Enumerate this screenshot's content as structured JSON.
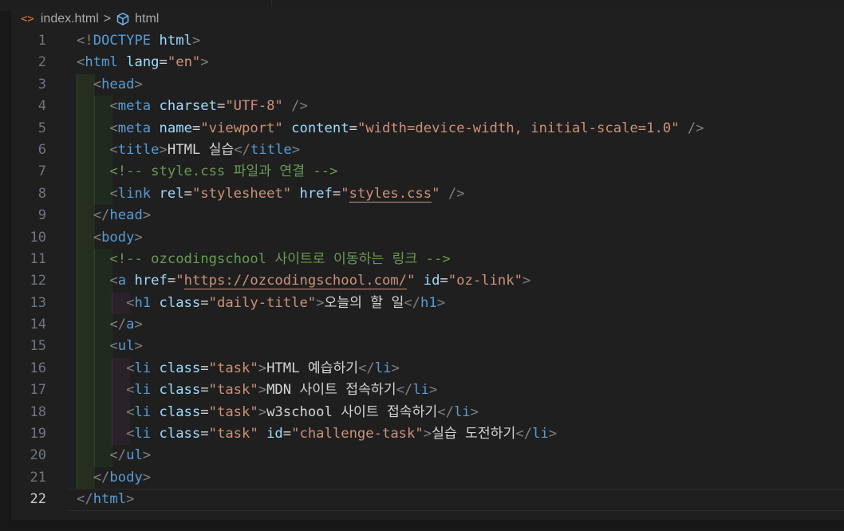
{
  "breadcrumb": {
    "file_icon": "<>",
    "file": "index.html",
    "separator": ">",
    "element": "html"
  },
  "colors": {
    "tag": "#569cd6",
    "attribute": "#9cdcfe",
    "string": "#ce9178",
    "comment": "#6a9955",
    "bracket": "#808080",
    "text": "#d4d4d4",
    "line_number": "#6e7681",
    "background": "#1f1f1f"
  },
  "active_line": 22,
  "lines": [
    {
      "n": "1",
      "tokens": [
        [
          "b",
          "<!"
        ],
        [
          "dt",
          "DOCTYPE"
        ],
        [
          "p",
          " "
        ],
        [
          "a",
          "html"
        ],
        [
          "b",
          ">"
        ]
      ]
    },
    {
      "n": "2",
      "tokens": [
        [
          "b",
          "<"
        ],
        [
          "t",
          "html"
        ],
        [
          "p",
          " "
        ],
        [
          "a",
          "lang"
        ],
        [
          "p",
          "="
        ],
        [
          "s",
          "\"en\""
        ],
        [
          "b",
          ">"
        ]
      ]
    },
    {
      "n": "3",
      "tokens": [
        [
          "p",
          "  "
        ],
        [
          "b",
          "<"
        ],
        [
          "t",
          "head"
        ],
        [
          "b",
          ">"
        ]
      ]
    },
    {
      "n": "4",
      "tokens": [
        [
          "p",
          "    "
        ],
        [
          "b",
          "<"
        ],
        [
          "t",
          "meta"
        ],
        [
          "p",
          " "
        ],
        [
          "a",
          "charset"
        ],
        [
          "p",
          "="
        ],
        [
          "s",
          "\"UTF-8\""
        ],
        [
          "p",
          " "
        ],
        [
          "b",
          "/>"
        ]
      ]
    },
    {
      "n": "5",
      "tokens": [
        [
          "p",
          "    "
        ],
        [
          "b",
          "<"
        ],
        [
          "t",
          "meta"
        ],
        [
          "p",
          " "
        ],
        [
          "a",
          "name"
        ],
        [
          "p",
          "="
        ],
        [
          "s",
          "\"viewport\""
        ],
        [
          "p",
          " "
        ],
        [
          "a",
          "content"
        ],
        [
          "p",
          "="
        ],
        [
          "s",
          "\"width=device-width, initial-scale=1.0\""
        ],
        [
          "p",
          " "
        ],
        [
          "b",
          "/>"
        ]
      ]
    },
    {
      "n": "6",
      "tokens": [
        [
          "p",
          "    "
        ],
        [
          "b",
          "<"
        ],
        [
          "t",
          "title"
        ],
        [
          "b",
          ">"
        ],
        [
          "p",
          "HTML 실습"
        ],
        [
          "b",
          "</"
        ],
        [
          "t",
          "title"
        ],
        [
          "b",
          ">"
        ]
      ]
    },
    {
      "n": "7",
      "tokens": [
        [
          "p",
          "    "
        ],
        [
          "c",
          "<!-- style.css 파일과 연결 -->"
        ]
      ]
    },
    {
      "n": "8",
      "tokens": [
        [
          "p",
          "    "
        ],
        [
          "b",
          "<"
        ],
        [
          "t",
          "link"
        ],
        [
          "p",
          " "
        ],
        [
          "a",
          "rel"
        ],
        [
          "p",
          "="
        ],
        [
          "s",
          "\"stylesheet\""
        ],
        [
          "p",
          " "
        ],
        [
          "a",
          "href"
        ],
        [
          "p",
          "="
        ],
        [
          "s",
          "\""
        ],
        [
          "su",
          "styles.css"
        ],
        [
          "s",
          "\""
        ],
        [
          "p",
          " "
        ],
        [
          "b",
          "/>"
        ]
      ]
    },
    {
      "n": "9",
      "tokens": [
        [
          "p",
          "  "
        ],
        [
          "b",
          "</"
        ],
        [
          "t",
          "head"
        ],
        [
          "b",
          ">"
        ]
      ]
    },
    {
      "n": "10",
      "tokens": [
        [
          "p",
          "  "
        ],
        [
          "b",
          "<"
        ],
        [
          "t",
          "body"
        ],
        [
          "b",
          ">"
        ]
      ]
    },
    {
      "n": "11",
      "tokens": [
        [
          "p",
          "    "
        ],
        [
          "c",
          "<!-- ozcodingschool 사이트로 이동하는 링크 -->"
        ]
      ]
    },
    {
      "n": "12",
      "tokens": [
        [
          "p",
          "    "
        ],
        [
          "b",
          "<"
        ],
        [
          "t",
          "a"
        ],
        [
          "p",
          " "
        ],
        [
          "a",
          "href"
        ],
        [
          "p",
          "="
        ],
        [
          "s",
          "\""
        ],
        [
          "su",
          "https://ozcodingschool.com/"
        ],
        [
          "s",
          "\""
        ],
        [
          "p",
          " "
        ],
        [
          "a",
          "id"
        ],
        [
          "p",
          "="
        ],
        [
          "s",
          "\"oz-link\""
        ],
        [
          "b",
          ">"
        ]
      ]
    },
    {
      "n": "13",
      "tokens": [
        [
          "p",
          "      "
        ],
        [
          "b",
          "<"
        ],
        [
          "t",
          "h1"
        ],
        [
          "p",
          " "
        ],
        [
          "a",
          "class"
        ],
        [
          "p",
          "="
        ],
        [
          "s",
          "\"daily-title\""
        ],
        [
          "b",
          ">"
        ],
        [
          "p",
          "오늘의 할 일"
        ],
        [
          "b",
          "</"
        ],
        [
          "t",
          "h1"
        ],
        [
          "b",
          ">"
        ]
      ]
    },
    {
      "n": "14",
      "tokens": [
        [
          "p",
          "    "
        ],
        [
          "b",
          "</"
        ],
        [
          "t",
          "a"
        ],
        [
          "b",
          ">"
        ]
      ]
    },
    {
      "n": "15",
      "tokens": [
        [
          "p",
          "    "
        ],
        [
          "b",
          "<"
        ],
        [
          "t",
          "ul"
        ],
        [
          "b",
          ">"
        ]
      ]
    },
    {
      "n": "16",
      "tokens": [
        [
          "p",
          "      "
        ],
        [
          "b",
          "<"
        ],
        [
          "t",
          "li"
        ],
        [
          "p",
          " "
        ],
        [
          "a",
          "class"
        ],
        [
          "p",
          "="
        ],
        [
          "s",
          "\"task\""
        ],
        [
          "b",
          ">"
        ],
        [
          "p",
          "HTML 예습하기"
        ],
        [
          "b",
          "</"
        ],
        [
          "t",
          "li"
        ],
        [
          "b",
          ">"
        ]
      ]
    },
    {
      "n": "17",
      "tokens": [
        [
          "p",
          "      "
        ],
        [
          "b",
          "<"
        ],
        [
          "t",
          "li"
        ],
        [
          "p",
          " "
        ],
        [
          "a",
          "class"
        ],
        [
          "p",
          "="
        ],
        [
          "s",
          "\"task\""
        ],
        [
          "b",
          ">"
        ],
        [
          "p",
          "MDN 사이트 접속하기"
        ],
        [
          "b",
          "</"
        ],
        [
          "t",
          "li"
        ],
        [
          "b",
          ">"
        ]
      ]
    },
    {
      "n": "18",
      "tokens": [
        [
          "p",
          "      "
        ],
        [
          "b",
          "<"
        ],
        [
          "t",
          "li"
        ],
        [
          "p",
          " "
        ],
        [
          "a",
          "class"
        ],
        [
          "p",
          "="
        ],
        [
          "s",
          "\"task\""
        ],
        [
          "b",
          ">"
        ],
        [
          "p",
          "w3school 사이트 접속하기"
        ],
        [
          "b",
          "</"
        ],
        [
          "t",
          "li"
        ],
        [
          "b",
          ">"
        ]
      ]
    },
    {
      "n": "19",
      "tokens": [
        [
          "p",
          "      "
        ],
        [
          "b",
          "<"
        ],
        [
          "t",
          "li"
        ],
        [
          "p",
          " "
        ],
        [
          "a",
          "class"
        ],
        [
          "p",
          "="
        ],
        [
          "s",
          "\"task\""
        ],
        [
          "p",
          " "
        ],
        [
          "a",
          "id"
        ],
        [
          "p",
          "="
        ],
        [
          "s",
          "\"challenge-task\""
        ],
        [
          "b",
          ">"
        ],
        [
          "p",
          "실습 도전하기"
        ],
        [
          "b",
          "</"
        ],
        [
          "t",
          "li"
        ],
        [
          "b",
          ">"
        ]
      ]
    },
    {
      "n": "20",
      "tokens": [
        [
          "p",
          "    "
        ],
        [
          "b",
          "</"
        ],
        [
          "t",
          "ul"
        ],
        [
          "b",
          ">"
        ]
      ]
    },
    {
      "n": "21",
      "tokens": [
        [
          "p",
          "  "
        ],
        [
          "b",
          "</"
        ],
        [
          "t",
          "body"
        ],
        [
          "b",
          ">"
        ]
      ]
    },
    {
      "n": "22",
      "tokens": [
        [
          "b",
          "</"
        ],
        [
          "t",
          "html"
        ],
        [
          "b",
          ">"
        ]
      ]
    }
  ]
}
